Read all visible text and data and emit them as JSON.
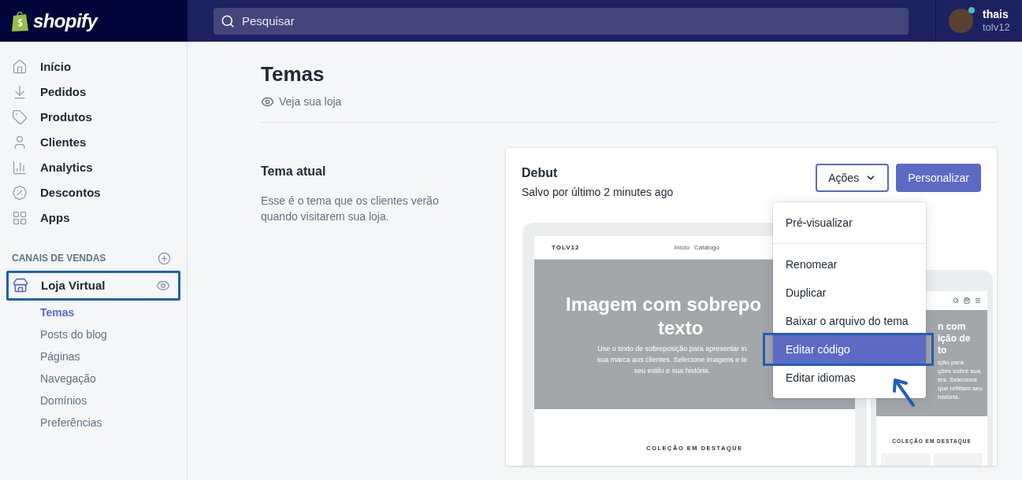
{
  "topbar": {
    "logo": "shopify",
    "search": {
      "placeholder": "Pesquisar"
    },
    "user": {
      "name": "thais",
      "store": "tolv12",
      "online": true
    }
  },
  "sidebar": {
    "items": [
      {
        "label": "Início"
      },
      {
        "label": "Pedidos"
      },
      {
        "label": "Produtos"
      },
      {
        "label": "Clientes"
      },
      {
        "label": "Analytics"
      },
      {
        "label": "Descontos"
      },
      {
        "label": "Apps"
      }
    ],
    "section": {
      "title": "CANAIS DE VENDAS",
      "channel": {
        "label": "Loja Virtual",
        "annotated": true,
        "children": [
          {
            "label": "Temas",
            "selected": true
          },
          {
            "label": "Posts do blog",
            "selected": false
          },
          {
            "label": "Páginas",
            "selected": false
          },
          {
            "label": "Navegação",
            "selected": false
          },
          {
            "label": "Domínios",
            "selected": false
          },
          {
            "label": "Preferências",
            "selected": false
          }
        ]
      }
    }
  },
  "page": {
    "title": "Temas",
    "view_link": "Veja sua loja",
    "current_theme": {
      "heading": "Tema atual",
      "description": "Esse é o tema que os clientes verão quando visitarem sua loja.",
      "theme": {
        "name": "Debut",
        "saved": "Salvo por último 2 minutes ago",
        "actions_button": "Ações",
        "customize_button": "Personalizar",
        "preview": {
          "store_name": "TOLV12",
          "nav": [
            "Início",
            "Catálogo"
          ],
          "hero_title": [
            "Imagem com sobrepo",
            "texto"
          ],
          "hero_text": [
            "Use o texto de sobreposição para apresentar in",
            "sua marca aos clientes. Selecione imagens e te",
            "seu estilo e sua história."
          ],
          "collection": "COLEÇÃO EM DESTAQUE",
          "mobile": {
            "hero_title": [
              "n com",
              "ição de",
              "to"
            ],
            "hero_text": [
              "ição para",
              "ções sobre sua",
              "tes. Selecione",
              "que reflitam seu",
              "história."
            ],
            "collection": "COLEÇÃO EM DESTAQUE"
          }
        },
        "menu": {
          "sections": [
            [
              {
                "label": "Pré-visualizar",
                "selected": false,
                "annotated": false
              }
            ],
            [
              {
                "label": "Renomear",
                "selected": false,
                "annotated": false
              },
              {
                "label": "Duplicar",
                "selected": false,
                "annotated": false
              },
              {
                "label": "Baixar o arquivo do tema",
                "selected": false,
                "annotated": false
              },
              {
                "label": "Editar código",
                "selected": true,
                "annotated": true
              },
              {
                "label": "Editar idiomas",
                "selected": false,
                "annotated": false
              }
            ]
          ]
        }
      }
    }
  }
}
